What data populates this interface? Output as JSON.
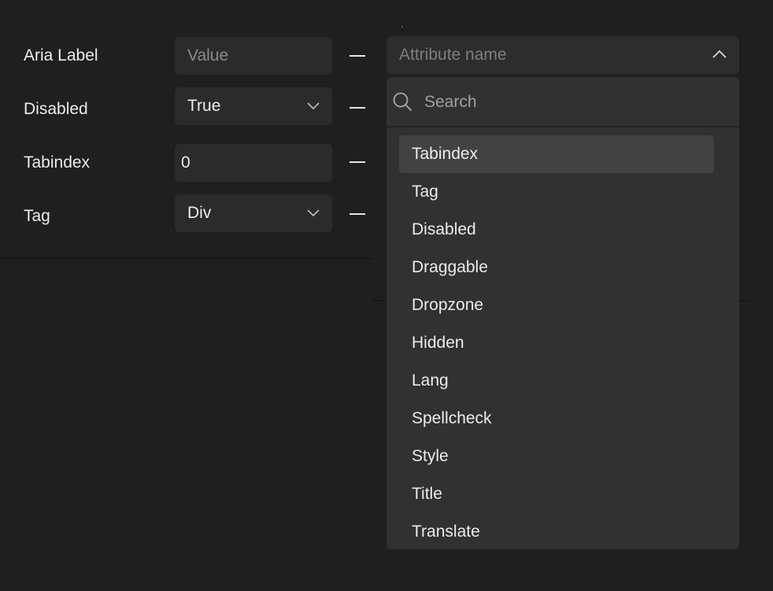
{
  "rows": [
    {
      "label": "Aria Label",
      "control": "input",
      "value": "",
      "placeholder": "Value"
    },
    {
      "label": "Disabled",
      "control": "select",
      "value": "True"
    },
    {
      "label": "Tabindex",
      "control": "input",
      "value": "0"
    },
    {
      "label": "Tag",
      "control": "select",
      "value": "Div"
    }
  ],
  "attribute_picker": {
    "placeholder": "Attribute name",
    "expanded": true,
    "search_placeholder": "Search",
    "highlighted_index": 0,
    "options": [
      "Tabindex",
      "Tag",
      "Disabled",
      "Draggable",
      "Dropzone",
      "Hidden",
      "Lang",
      "Spellcheck",
      "Style",
      "Title",
      "Translate"
    ]
  },
  "icons": {
    "select_chevron": "chevron-down-icon",
    "combo_chevron": "chevron-up-icon",
    "search": "search-icon",
    "remove": "minus-icon"
  },
  "colors": {
    "background": "#1f1f1f",
    "field": "#2b2b2b",
    "dropdown": "#313131",
    "highlight": "#424242",
    "text": "#ececec",
    "placeholder": "#7f7f7f"
  }
}
